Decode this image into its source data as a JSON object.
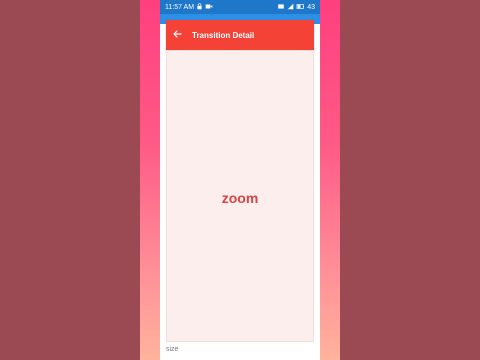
{
  "status_bar": {
    "time": "11:57 AM",
    "battery": "43",
    "left_icons": [
      "lock-icon",
      "video-icon"
    ],
    "right_icons": [
      "sim-icon",
      "signal-icon",
      "battery-icon"
    ]
  },
  "app_bar": {
    "back_icon": "arrow-left-icon",
    "title": "Transition Detail"
  },
  "content": {
    "label": "zoom"
  },
  "footer": {
    "label": "size"
  },
  "colors": {
    "appbar_red": "#f44336",
    "status_blue": "#1f77c9",
    "card_bg": "#fdeeee",
    "label_red": "#d84343"
  }
}
